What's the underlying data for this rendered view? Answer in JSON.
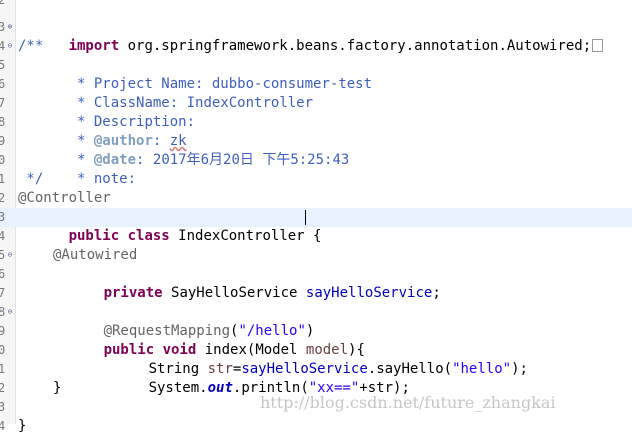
{
  "editor": {
    "gutter_numbers": [
      "2",
      "3",
      "4",
      "5",
      "6",
      "7",
      "8",
      "9",
      "0",
      "1",
      "2",
      "3",
      "4",
      "5",
      "6",
      "7",
      "8",
      "9",
      "0",
      "1",
      "2",
      "3",
      "4"
    ],
    "lines": {
      "l3": {
        "import_kw": "import",
        "import_rest": " org.springframework.beans.factory.annotation.Autowired;"
      },
      "l4": {
        "text": "/**"
      },
      "l5": {
        "prefix": " * ",
        "key": "Project Name:",
        "value": " dubbo-consumer-test"
      },
      "l6": {
        "prefix": " * ",
        "key": "ClassName:",
        "value": " IndexController"
      },
      "l7": {
        "prefix": " * ",
        "key": "Description:"
      },
      "l8": {
        "prefix": " * ",
        "tag": "@author",
        "colon": ": ",
        "value": "zk"
      },
      "l9": {
        "prefix": " * ",
        "tag": "@date",
        "colon": ": ",
        "value": "2017年6月20日 下午5:25:43"
      },
      "l10": {
        "prefix": " * ",
        "key": "note:"
      },
      "l11": {
        "text": " */"
      },
      "l12": {
        "annotation": "@Controller"
      },
      "l13": {
        "kw1": "public",
        "kw2": "class",
        "rest": " IndexController {"
      },
      "l15": {
        "annotation": "@Autowired"
      },
      "l16": {
        "kw": "private",
        "type": " SayHelloService ",
        "field": "sayHelloService",
        "end": ";"
      },
      "l18": {
        "annotation": "@RequestMapping",
        "open": "(",
        "string": "\"/hello\"",
        "close": ")"
      },
      "l19": {
        "kw1": "public",
        "kw2": "void",
        "method": " index(Model ",
        "param": "model",
        "end": "){"
      },
      "l20": {
        "type": "String ",
        "local": "str",
        "eq": "=",
        "field": "sayHelloService",
        "call": ".sayHello(",
        "string": "\"hello\"",
        "end": ");"
      },
      "l21": {
        "cls": "System.",
        "static_field": "out",
        "call": ".println(",
        "string": "\"xx==\"",
        "plus": "+str);"
      },
      "l22": {
        "text": "}"
      },
      "l24": {
        "text": "}"
      }
    }
  },
  "watermark": "http://blog.csdn.net/future_zhangkai",
  "colors": {
    "keyword": "#7f0055",
    "javadoc": "#3f5fbf",
    "javadoc_tag": "#7f9fbf",
    "annotation": "#646464",
    "string": "#2a00ff",
    "field": "#0000c0",
    "current_line": "#e8f2fe"
  },
  "icons": {
    "expand": "plus-in-circle",
    "collapse": "minus-in-circle",
    "folded_import": "folded-region-box"
  }
}
